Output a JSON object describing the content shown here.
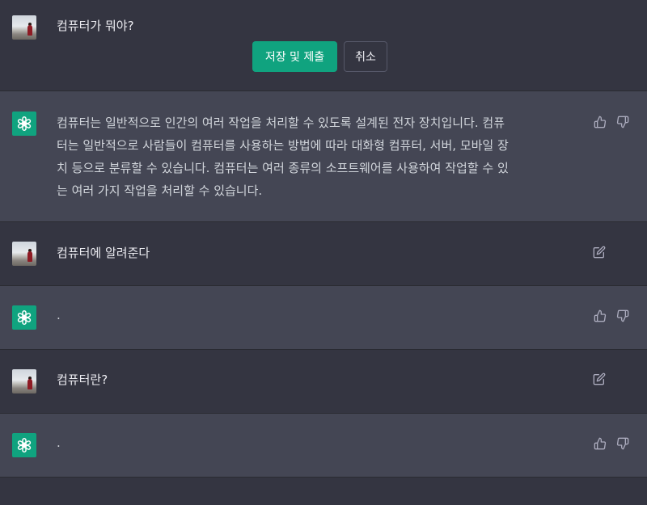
{
  "edit_panel": {
    "question": "컴퓨터가 뭐야?",
    "save_label": "저장 및 제출",
    "cancel_label": "취소"
  },
  "messages": [
    {
      "role": "assistant",
      "text": "컴퓨터는 일반적으로 인간의 여러 작업을 처리할 수 있도록 설계된 전자 장치입니다. 컴퓨\n터는 일반적으로 사람들이 컴퓨터를 사용하는 방법에 따라 대화형 컴퓨터, 서버, 모바일 장\n치 등으로 분류할 수 있습니다. 컴퓨터는 여러 종류의 소프트웨어를 사용하여 작업할 수 있\n는 여러 가지 작업을 처리할 수 있습니다."
    },
    {
      "role": "user",
      "text": "컴퓨터에 알려준다"
    },
    {
      "role": "assistant",
      "text": "."
    },
    {
      "role": "user",
      "text": "컴퓨터란?"
    },
    {
      "role": "assistant",
      "text": "."
    }
  ],
  "icons": {
    "like": "thumbs-up-icon",
    "dislike": "thumbs-down-icon",
    "edit": "edit-icon",
    "bot_avatar": "openai-logo-icon"
  },
  "colors": {
    "background": "#343541",
    "assistant_row": "#444654",
    "accent": "#10a37f"
  }
}
